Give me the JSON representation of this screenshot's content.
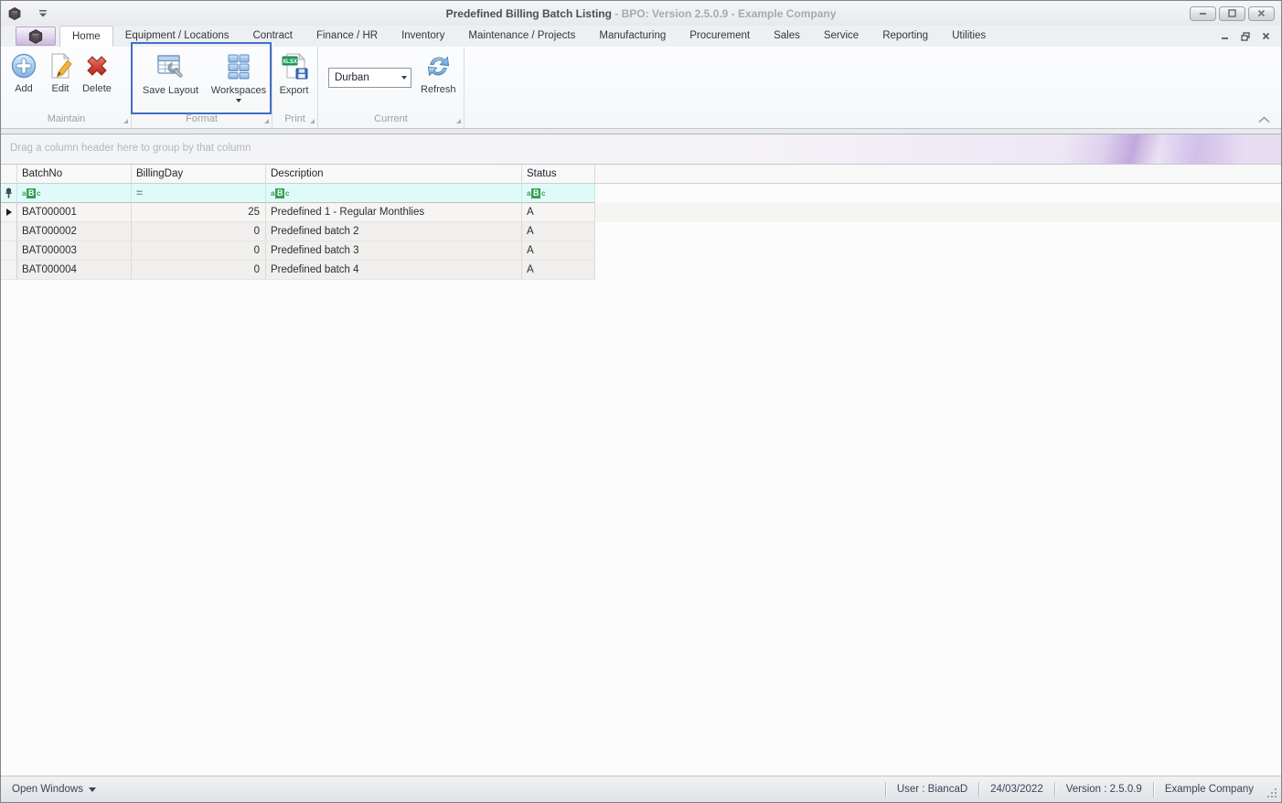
{
  "window": {
    "title": "Predefined Billing Batch Listing",
    "title_suffix": "- BPO: Version 2.5.0.9 - Example Company"
  },
  "tabs": [
    "Home",
    "Equipment / Locations",
    "Contract",
    "Finance / HR",
    "Inventory",
    "Maintenance / Projects",
    "Manufacturing",
    "Procurement",
    "Sales",
    "Service",
    "Reporting",
    "Utilities"
  ],
  "ribbon": {
    "maintain": {
      "label": "Maintain",
      "add": "Add",
      "edit": "Edit",
      "delete": "Delete"
    },
    "format": {
      "label": "Format",
      "save_layout": "Save Layout",
      "workspaces": "Workspaces"
    },
    "print": {
      "label": "Print",
      "export": "Export",
      "export_badge": "XLSX"
    },
    "current": {
      "label": "Current",
      "site": "Durban",
      "refresh": "Refresh"
    }
  },
  "grid": {
    "group_panel": "Drag a column header here to group by that column",
    "columns": [
      "BatchNo",
      "BillingDay",
      "Description",
      "Status"
    ],
    "filter_glyphs": {
      "a": "a",
      "b": "B",
      "c": "c",
      "numeric": "="
    },
    "rows": [
      {
        "batch": "BAT000001",
        "day": "25",
        "desc": "Predefined 1 - Regular Monthlies",
        "status": "A"
      },
      {
        "batch": "BAT000002",
        "day": "0",
        "desc": "Predefined batch 2",
        "status": "A"
      },
      {
        "batch": "BAT000003",
        "day": "0",
        "desc": "Predefined batch 3",
        "status": "A"
      },
      {
        "batch": "BAT000004",
        "day": "0",
        "desc": "Predefined batch 4",
        "status": "A"
      }
    ]
  },
  "statusbar": {
    "open_windows": "Open Windows",
    "user": "User : BiancaD",
    "date": "24/03/2022",
    "version": "Version : 2.5.0.9",
    "company": "Example Company"
  },
  "colors": {
    "highlight_border": "#3f6fc6",
    "filter_row_bg": "#e0fafa",
    "abc_green": "#35a055",
    "xlsx_green": "#21a366"
  }
}
